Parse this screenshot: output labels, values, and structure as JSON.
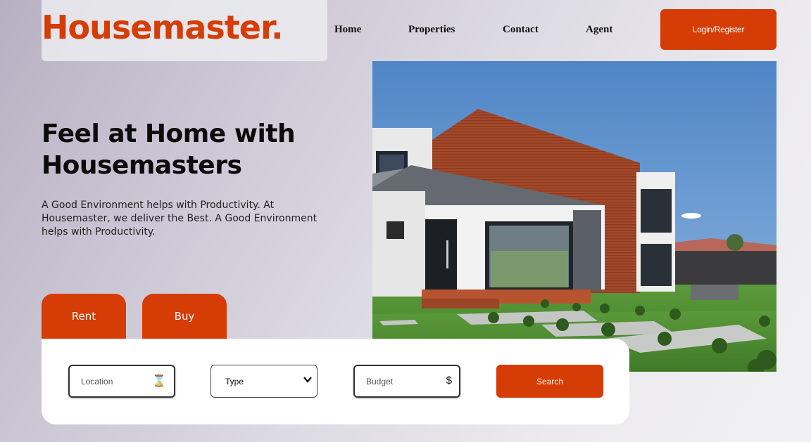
{
  "brand": {
    "logo": "Housemaster.",
    "accent_color": "#d63c06"
  },
  "nav": {
    "links": [
      "Home",
      "Properties",
      "Contact",
      "Agent"
    ],
    "login_label": "Login/Register"
  },
  "hero": {
    "title_line1": "Feel at Home with",
    "title_line2": "Housemasters",
    "description": "A Good Environment helps with Productivity. At Housemaster, we deliver the Best. A Good Environment helps with Productivity."
  },
  "tabs": [
    "Rent",
    "Buy"
  ],
  "search": {
    "location_placeholder": "Location",
    "location_icon": "hourglass-icon",
    "type_value": "Type",
    "budget_placeholder": "Budget",
    "budget_icon": "$",
    "search_label": "Search"
  }
}
